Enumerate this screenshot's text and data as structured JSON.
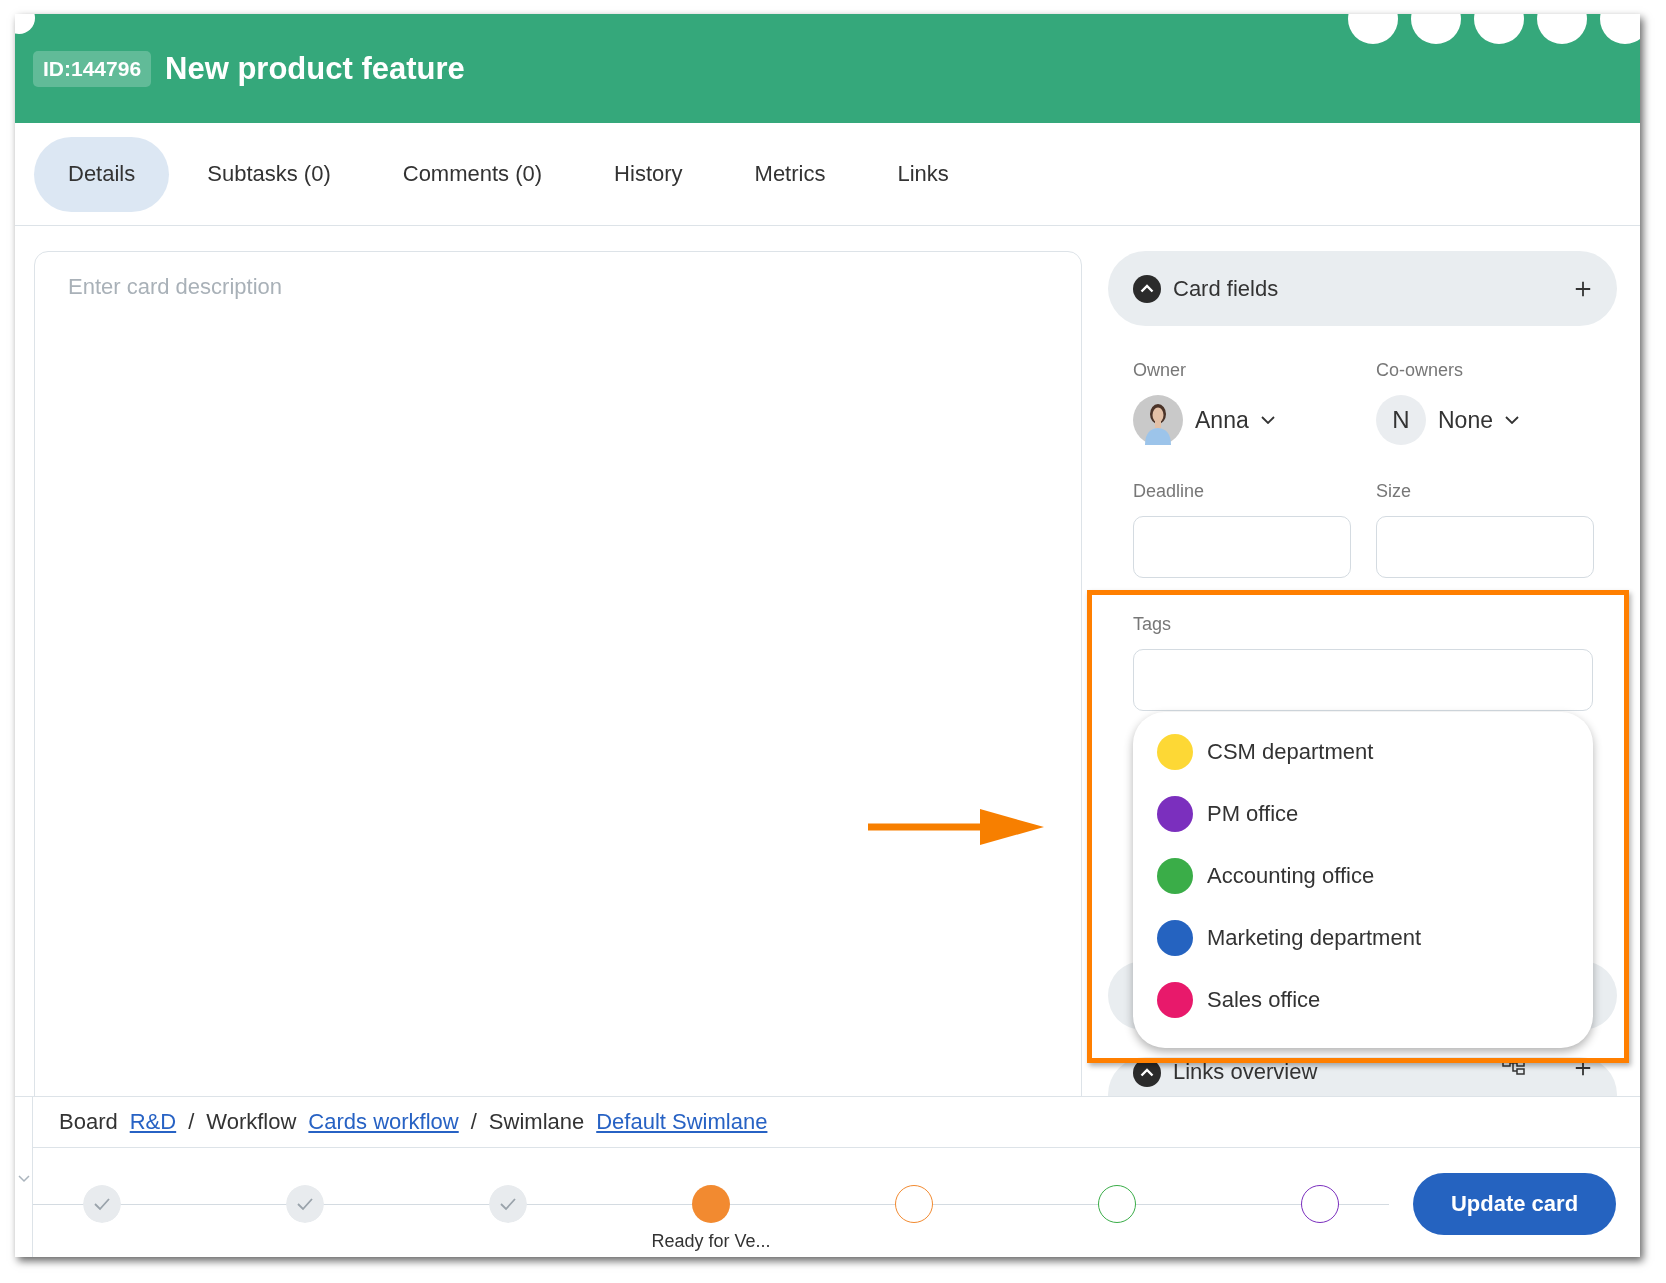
{
  "header": {
    "id_badge": "ID:144796",
    "title": "New product feature"
  },
  "tabs": [
    {
      "label": "Details",
      "selected": true
    },
    {
      "label": "Subtasks (0)",
      "selected": false
    },
    {
      "label": "Comments (0)",
      "selected": false
    },
    {
      "label": "History",
      "selected": false
    },
    {
      "label": "Metrics",
      "selected": false
    },
    {
      "label": "Links",
      "selected": false
    }
  ],
  "description": {
    "placeholder": "Enter card description"
  },
  "card_fields": {
    "title": "Card fields",
    "expanded": true,
    "owner": {
      "label": "Owner",
      "value": "Anna"
    },
    "co_owners": {
      "label": "Co-owners",
      "initial": "N",
      "value": "None"
    },
    "deadline": {
      "label": "Deadline"
    },
    "size": {
      "label": "Size"
    },
    "tags": {
      "label": "Tags",
      "options": [
        {
          "label": "CSM department",
          "color": "#fdd835"
        },
        {
          "label": "PM office",
          "color": "#7b2fbe"
        },
        {
          "label": "Accounting office",
          "color": "#3aad48"
        },
        {
          "label": "Marketing department",
          "color": "#2563c0"
        },
        {
          "label": "Sales office",
          "color": "#e8196b"
        }
      ]
    }
  },
  "links_overview": {
    "title": "Links overview",
    "expanded": true
  },
  "breadcrumb": [
    {
      "kind": "text",
      "text": "Board"
    },
    {
      "kind": "link",
      "text": "R&D"
    },
    {
      "kind": "text",
      "text": "/"
    },
    {
      "kind": "text",
      "text": "Workflow"
    },
    {
      "kind": "link",
      "text": "Cards workflow"
    },
    {
      "kind": "text",
      "text": "/"
    },
    {
      "kind": "text",
      "text": "Swimlane"
    },
    {
      "kind": "link",
      "text": "Default Swimlane"
    }
  ],
  "steps": [
    {
      "completed": true,
      "current": false
    },
    {
      "completed": true,
      "current": false
    },
    {
      "completed": true,
      "current": false
    },
    {
      "completed": false,
      "current": true,
      "color": "#f28a30",
      "label": "Ready for Ve..."
    },
    {
      "completed": false,
      "current": false,
      "color": "#f28a30"
    },
    {
      "completed": false,
      "current": false,
      "color": "#3aad48"
    },
    {
      "completed": false,
      "current": false,
      "color": "#7b2fbe"
    }
  ],
  "update_button": "Update card"
}
